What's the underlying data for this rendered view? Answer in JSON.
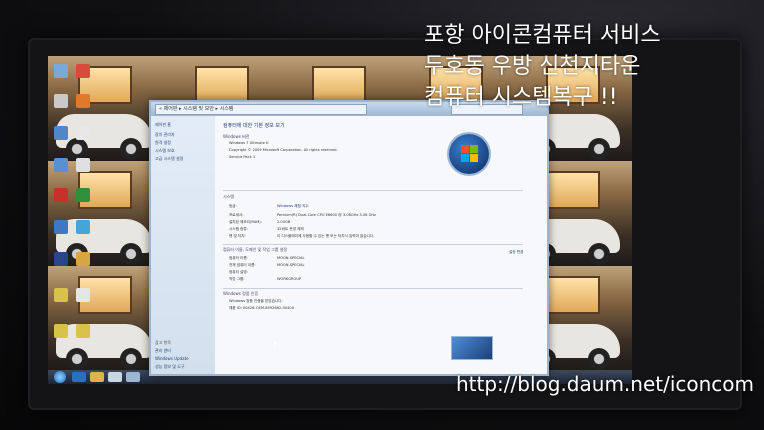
{
  "caption": {
    "line1": "포항 아이콘컴퓨터 서비스",
    "line2": "두호동 우방 신천지타운",
    "line3": "컴퓨터 시스템복구 !!"
  },
  "watermark": "http://blog.daum.net/iconcom",
  "screen_window": {
    "address": "« 제어판 ▸ 시스템 및 보안 ▸ 시스템",
    "title": "컴퓨터에 대한 기본 정보 보기",
    "edition_heading": "Windows 버전",
    "edition": "Windows 7 Ultimate K",
    "copyright": "Copyright © 2009 Microsoft Corporation. All rights reserved.",
    "service_pack": "Service Pack 1",
    "system_heading": "시스템",
    "rating_label": "등급:",
    "rating_value": "Windows 체험 지수",
    "processor_label": "프로세서:",
    "processor_value": "Pentium(R) Dual-Core CPU   E6600 @ 3.06GHz   3.06 GHz",
    "memory_label": "설치된 메모리(RAM):",
    "memory_value": "2.00GB",
    "type_label": "시스템 종류:",
    "type_value": "32비트 운영 체제",
    "pen_label": "펜 및 터치:",
    "pen_value": "이 디스플레이에 사용할 수 있는 펜 또는 터치식 입력이 없습니다.",
    "network_heading": "컴퓨터 이름, 도메인 및 작업 그룹 설정",
    "computer_name_label": "컴퓨터 이름:",
    "computer_name_value": "MOON-SPECIAL",
    "full_name_label": "전체 컴퓨터 이름:",
    "full_name_value": "MOON-SPECIAL",
    "description_label": "컴퓨터 설명:",
    "workgroup_label": "작업 그룹:",
    "workgroup_value": "WORKGROUP",
    "change_settings": "설정 변경",
    "activation_heading": "Windows 정품 인증",
    "activation_status": "Windows 정품 인증을 받았습니다.",
    "product_id": "제품 ID: 00426-OEM-8992662-00400",
    "side_items": [
      "제어판 홈",
      "장치 관리자",
      "원격 설정",
      "시스템 보호",
      "고급 시스템 설정"
    ],
    "see_also_heading": "참고 항목",
    "see_also_items": [
      "관리 센터",
      "Windows Update",
      "성능 정보 및 도구"
    ]
  }
}
